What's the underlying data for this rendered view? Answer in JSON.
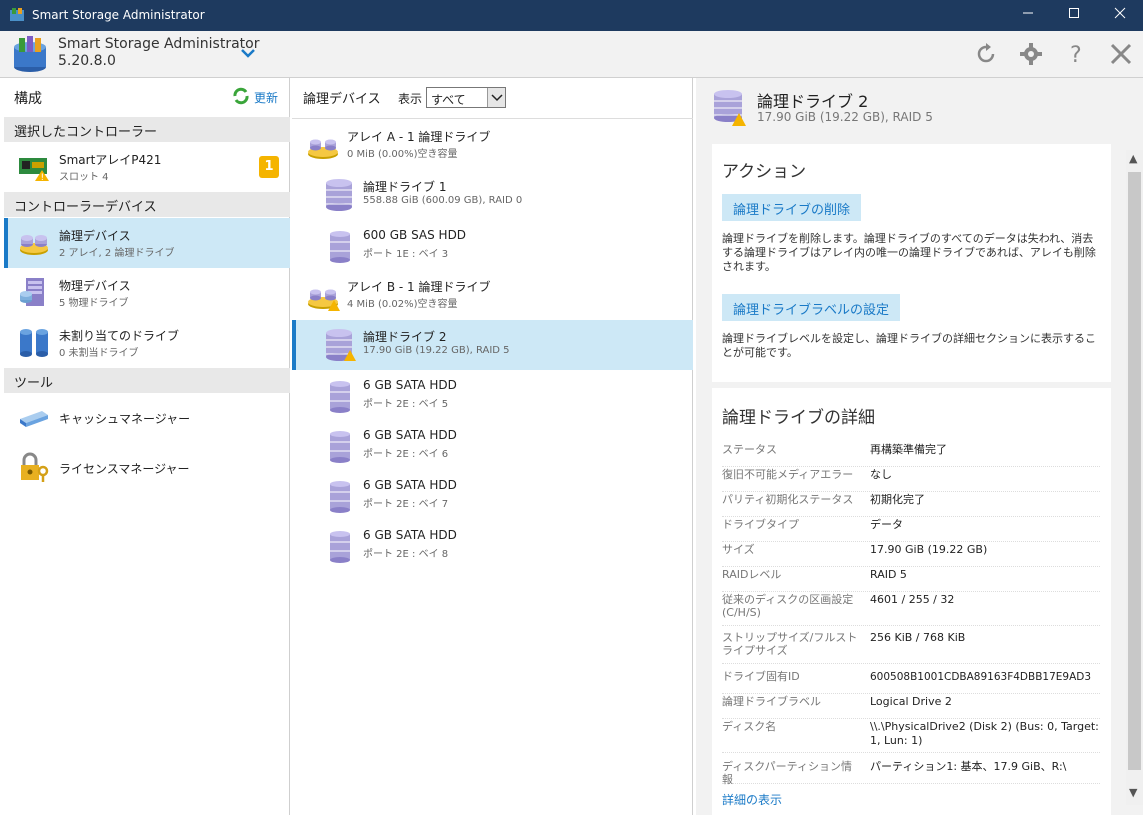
{
  "window": {
    "title": "Smart Storage Administrator"
  },
  "header": {
    "app_name": "Smart Storage Administrator",
    "version": "5.20.8.0"
  },
  "left_panel": {
    "title": "構成",
    "refresh_label": "更新",
    "section_controller": "選択したコントローラー",
    "controller": {
      "name": "SmartアレイP421",
      "sub": "スロット 4",
      "badge": "1"
    },
    "section_devices": "コントローラーデバイス",
    "devices": [
      {
        "label": "論理デバイス",
        "sub": "2 アレイ, 2 論理ドライブ"
      },
      {
        "label": "物理デバイス",
        "sub": "5 物理ドライブ"
      },
      {
        "label": "未割り当てのドライブ",
        "sub": "0 未割当ドライブ"
      }
    ],
    "section_tools": "ツール",
    "tools": [
      {
        "label": "キャッシュマネージャー"
      },
      {
        "label": "ライセンスマネージャー"
      }
    ]
  },
  "middle_panel": {
    "title": "論理デバイス",
    "filter_label": "表示",
    "filter_value": "すべて",
    "items": [
      {
        "title": "アレイ A - 1 論理ドライブ",
        "sub": "0 MiB (0.00%)空き容量"
      },
      {
        "title": "論理ドライブ 1",
        "sub": "558.88 GiB (600.09 GB), RAID 0"
      },
      {
        "title": "600 GB SAS HDD",
        "sub": "ポート 1E : ベイ 3"
      },
      {
        "title": "アレイ B - 1 論理ドライブ",
        "sub": "4 MiB (0.02%)空き容量"
      },
      {
        "title": "論理ドライブ 2",
        "sub": "17.90 GiB (19.22 GB), RAID 5"
      },
      {
        "title": "6 GB SATA HDD",
        "sub": "ポート 2E : ベイ 5"
      },
      {
        "title": "6 GB SATA HDD",
        "sub": "ポート 2E : ベイ 6"
      },
      {
        "title": "6 GB SATA HDD",
        "sub": "ポート 2E : ベイ 7"
      },
      {
        "title": "6 GB SATA HDD",
        "sub": "ポート 2E : ベイ 8"
      }
    ]
  },
  "right_panel": {
    "title": "論理ドライブ 2",
    "subtitle": "17.90 GiB (19.22 GB), RAID 5",
    "actions_title": "アクション",
    "action1_label": "論理ドライブの削除",
    "action1_desc": "論理ドライブを削除します。論理ドライブのすべてのデータは失われ、消去する論理ドライブはアレイ内の唯一の論理ドライブであれば、アレイも削除されます。",
    "action2_label": "論理ドライブラベルの設定",
    "action2_desc": "論理ドライブレベルを設定し、論理ドライブの詳細セクションに表示することが可能です。",
    "details_title": "論理ドライブの詳細",
    "details": [
      {
        "key": "ステータス",
        "value": "再構築準備完了"
      },
      {
        "key": "復旧不可能メディアエラー",
        "value": "なし"
      },
      {
        "key": "パリティ初期化ステータス",
        "value": "初期化完了"
      },
      {
        "key": "ドライブタイプ",
        "value": "データ"
      },
      {
        "key": "サイズ",
        "value": "17.90 GiB (19.22 GB)"
      },
      {
        "key": "RAIDレベル",
        "value": "RAID 5"
      },
      {
        "key": "従来のディスクの区画設定 (C/H/S)",
        "value": "4601 / 255 / 32"
      },
      {
        "key": "ストリップサイズ/フルストライプサイズ",
        "value": "256 KiB / 768 KiB"
      },
      {
        "key": "ドライブ固有ID",
        "value": "600508B1001CDBA89163F4DBB17E9AD3"
      },
      {
        "key": "論理ドライブラベル",
        "value": "Logical Drive 2"
      },
      {
        "key": "ディスク名",
        "value": "\\\\.\\PhysicalDrive2 (Disk 2) (Bus: 0, Target: 1, Lun: 1)"
      },
      {
        "key": "ディスクパーティション情報",
        "value": "パーティション1: 基本、17.9 GiB、R:\\"
      }
    ],
    "more_link": "詳細の表示"
  },
  "colors": {
    "titlebar": "#1e3a5f",
    "accent": "#1a7ac7",
    "selection": "#cde8f6",
    "badge": "#f5b400"
  }
}
